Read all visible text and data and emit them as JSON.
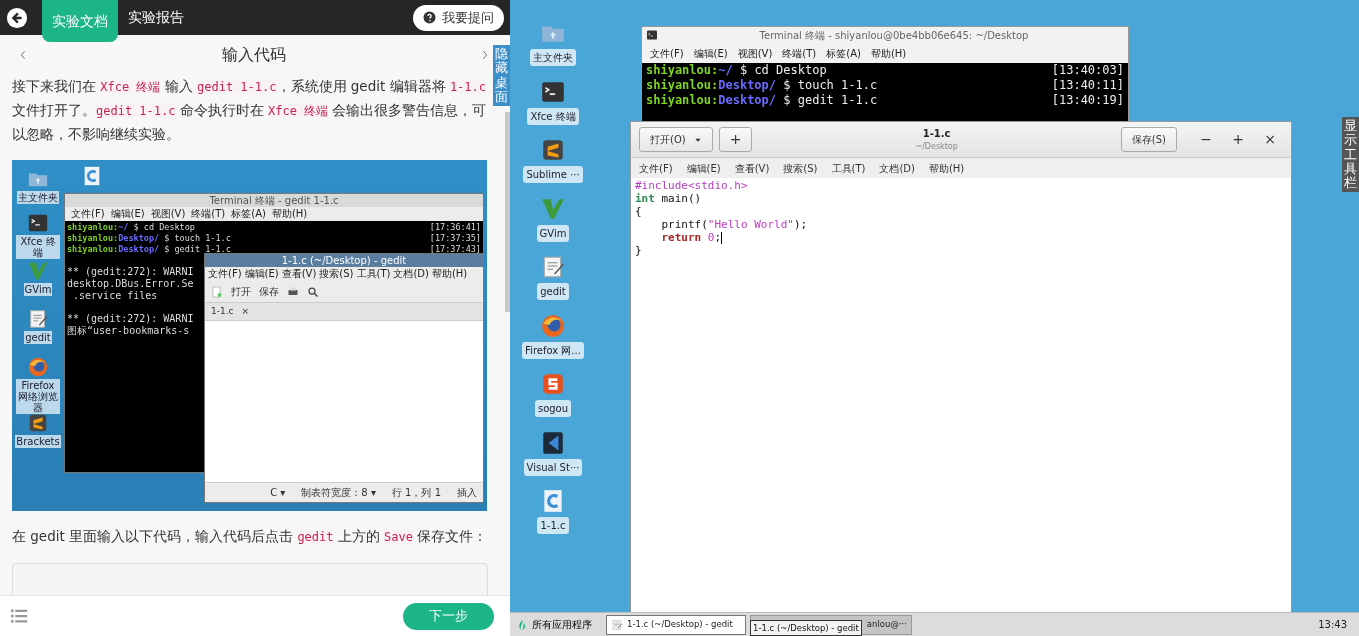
{
  "tutorial": {
    "top_tabs": [
      {
        "label": "实验文档",
        "selected": true
      },
      {
        "label": "实验报告",
        "selected": false
      }
    ],
    "ask_button": "我要提问",
    "step_title": "输入代码",
    "hide_desktop_tab": "隐藏桌面",
    "paragraph_1": [
      {
        "text": "接下来我们在 ",
        "code": false
      },
      {
        "text": "Xfce 终端",
        "code": true
      },
      {
        "text": " 输入 ",
        "code": false
      },
      {
        "text": "gedit 1-1.c",
        "code": true
      },
      {
        "text": "，系统使用 gedit 编辑器将 ",
        "code": false
      },
      {
        "text": "1-1.c",
        "code": true
      },
      {
        "text": " 文件打开了。",
        "code": false
      },
      {
        "text": "gedit 1-1.c",
        "code": true
      },
      {
        "text": " 命令执行时在 ",
        "code": false
      },
      {
        "text": "Xfce 终端",
        "code": true
      },
      {
        "text": " 会输出很多警告信息，可以忽略，不影响继续实验。",
        "code": false
      }
    ],
    "screenshot": {
      "icons": [
        "主文件夹",
        "Xfce 终端",
        "GVim",
        "gedit",
        "Firefox 网络浏览器",
        "Brackets"
      ],
      "terminal": {
        "title": "Terminal 终端 - gedit 1-1.c",
        "menu": [
          "文件(F)",
          "编辑(E)",
          "视图(V)",
          "终端(T)",
          "标签(A)",
          "帮助(H)"
        ],
        "lines": [
          {
            "user": "shiyanlou:",
            "path": "~/",
            "command": "$ cd Desktop",
            "time": "[17:36:41]"
          },
          {
            "user": "shiyanlou:",
            "path": "Desktop/",
            "command": "$ touch 1-1.c",
            "time": "[17:37:35]"
          },
          {
            "user": "shiyanlou:",
            "path": "Desktop/",
            "command": "$ gedit 1-1.c",
            "time": "[17:37:43]"
          }
        ],
        "output": [
          "** (gedit:272): WARNI",
          "desktop.DBus.Error.Se",
          " .service files",
          "** (gedit:272): WARNI",
          "图标“user-bookmarks-s"
        ]
      },
      "gedit": {
        "title": "1-1.c (~/Desktop) - gedit",
        "menu": [
          "文件(F)",
          "编辑(E)",
          "查看(V)",
          "搜索(S)",
          "工具(T)",
          "文档(D)",
          "帮助(H)"
        ],
        "open": "打开",
        "save": "保存",
        "tab": "1-1.c",
        "close": "×",
        "status": [
          "C ▾",
          "制表符宽度：8 ▾",
          "行 1，列 1",
          "插入"
        ]
      }
    },
    "paragraph_2": [
      {
        "text": "在 gedit 里面输入以下代码，输入代码后点击 ",
        "code": false
      },
      {
        "text": "gedit",
        "code": true
      },
      {
        "text": " 上方的 ",
        "code": false
      },
      {
        "text": "Save",
        "code": true
      },
      {
        "text": " 保存文件：",
        "code": false
      }
    ],
    "next_button": "下一步"
  },
  "desktop": {
    "icons": [
      "主文件夹",
      "Xfce 终端",
      "Sublime ···",
      "GVim",
      "gedit",
      "Firefox 网...",
      "sogou",
      "Visual St···",
      "1-1.c"
    ],
    "terminal": {
      "title": "Terminal 终端 - shiyanlou@0be4bb06e645: ~/Desktop",
      "menu": [
        "文件(F)",
        "编辑(E)",
        "视图(V)",
        "终端(T)",
        "标签(A)",
        "帮助(H)"
      ],
      "lines": [
        {
          "user": "shiyanlou:",
          "path": "~/",
          "command": "$ cd Desktop",
          "time": "[13:40:03]"
        },
        {
          "user": "shiyanlou:",
          "path": "Desktop/",
          "command": "$ touch 1-1.c",
          "time": "[13:40:11]"
        },
        {
          "user": "shiyanlou:",
          "path": "Desktop/",
          "command": "$ gedit 1-1.c",
          "time": "[13:40:19]"
        }
      ]
    },
    "gedit": {
      "open_button": "打开(O)",
      "new_tab_button": "+",
      "title": "1-1.c",
      "subtitle": "~/Desktop",
      "save_button": "保存(S)",
      "window_controls": [
        "−",
        "+",
        "×"
      ],
      "menu": [
        "文件(F)",
        "编辑(E)",
        "查看(V)",
        "搜索(S)",
        "工具(T)",
        "文档(D)",
        "帮助(H)"
      ],
      "code": [
        {
          "cursor": false,
          "tokens": [
            {
              "text": "#include<stdio.h>",
              "kind": "preproc"
            }
          ]
        },
        {
          "cursor": false,
          "tokens": [
            {
              "text": "int",
              "kind": "type"
            },
            {
              "text": " main()",
              "kind": "plain"
            }
          ]
        },
        {
          "cursor": false,
          "tokens": [
            {
              "text": "{",
              "kind": "plain"
            }
          ]
        },
        {
          "cursor": false,
          "tokens": [
            {
              "text": "    printf(",
              "kind": "plain"
            },
            {
              "text": "\"Hello World\"",
              "kind": "string"
            },
            {
              "text": ");",
              "kind": "plain"
            }
          ]
        },
        {
          "cursor": true,
          "tokens": [
            {
              "text": "    return",
              "kind": "keyword"
            },
            {
              "text": " 0",
              "kind": "number"
            },
            {
              "text": ";",
              "kind": "plain"
            }
          ]
        },
        {
          "cursor": false,
          "tokens": [
            {
              "text": "}",
              "kind": "plain"
            }
          ]
        }
      ]
    },
    "show_toolbar_tab": "显示工具栏",
    "taskbar": {
      "start": "所有应用程序",
      "windows": [
        {
          "label": "1-1.c (~/Desktop) - gedit",
          "selected": true
        },
        {
          "label": "anlou@···",
          "selected": false
        }
      ],
      "tooltip": "1-1.c (~/Desktop) - gedit",
      "clock": "13:43"
    }
  }
}
